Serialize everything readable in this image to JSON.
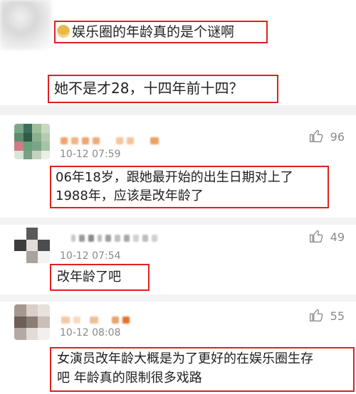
{
  "post": {
    "title": "娱乐圈的年龄真的是个谜啊",
    "quote": "她不是才28，十四年前十四？"
  },
  "comments": [
    {
      "time": "10-12 07:59",
      "likes": "96",
      "text_line1": "06年18岁，跟她最开始的出生日期对上了",
      "text_line2": "1988年，应该是改年龄了"
    },
    {
      "time": "10-12 07:54",
      "likes": "49",
      "text_line1": "改年龄了吧"
    },
    {
      "time": "10-12 08:08",
      "likes": "55",
      "text_line1": "女演员改年龄大概是为了更好的在娱乐圈生存",
      "text_line2": "吧 年龄真的限制很多戏路"
    }
  ],
  "colors": {
    "highlight_border": "#e02020",
    "time_text": "#8a8a8a",
    "separator": "#f4f4f4"
  },
  "icons": {
    "like": "thumb-up-icon",
    "title_emoji": "dog-face-icon"
  }
}
